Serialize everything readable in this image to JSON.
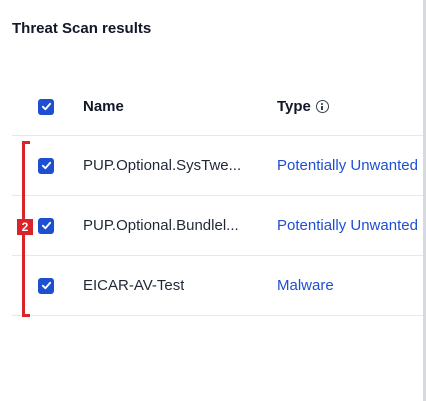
{
  "page": {
    "title": "Threat Scan results"
  },
  "table": {
    "header": {
      "name": "Name",
      "type": "Type",
      "select_all_checked": true
    },
    "rows": [
      {
        "checked": true,
        "name": "PUP.Optional.SysTwe...",
        "type": "Potentially Unwanted Program"
      },
      {
        "checked": true,
        "name": "PUP.Optional.Bundlel...",
        "type": "Potentially Unwanted Program"
      },
      {
        "checked": true,
        "name": "EICAR-AV-Test",
        "type": "Malware"
      }
    ]
  },
  "annotation": {
    "label": "2",
    "color": "#d9252a"
  },
  "colors": {
    "accent": "#1f4fd1",
    "annotation": "#d9252a"
  }
}
